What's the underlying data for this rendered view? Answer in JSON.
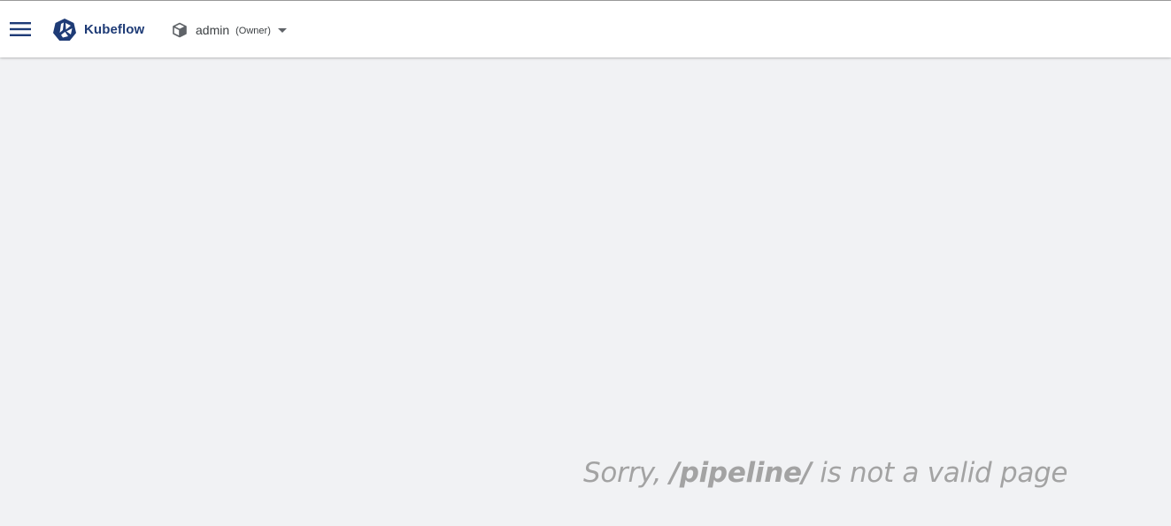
{
  "header": {
    "brand_name": "Kubeflow",
    "namespace": {
      "name": "admin",
      "role": "(Owner)"
    }
  },
  "main": {
    "error": {
      "prefix": "Sorry, ",
      "path": "/pipeline/",
      "suffix": " is not a valid page"
    }
  },
  "icons": {
    "menu": "menu-icon",
    "logo": "kubeflow-logo-icon",
    "namespace": "cube-icon",
    "dropdown": "arrow-drop-down-icon"
  },
  "colors": {
    "brand": "#1e3b76",
    "background": "#f1f2f4",
    "error_text": "#a3a3a3"
  }
}
